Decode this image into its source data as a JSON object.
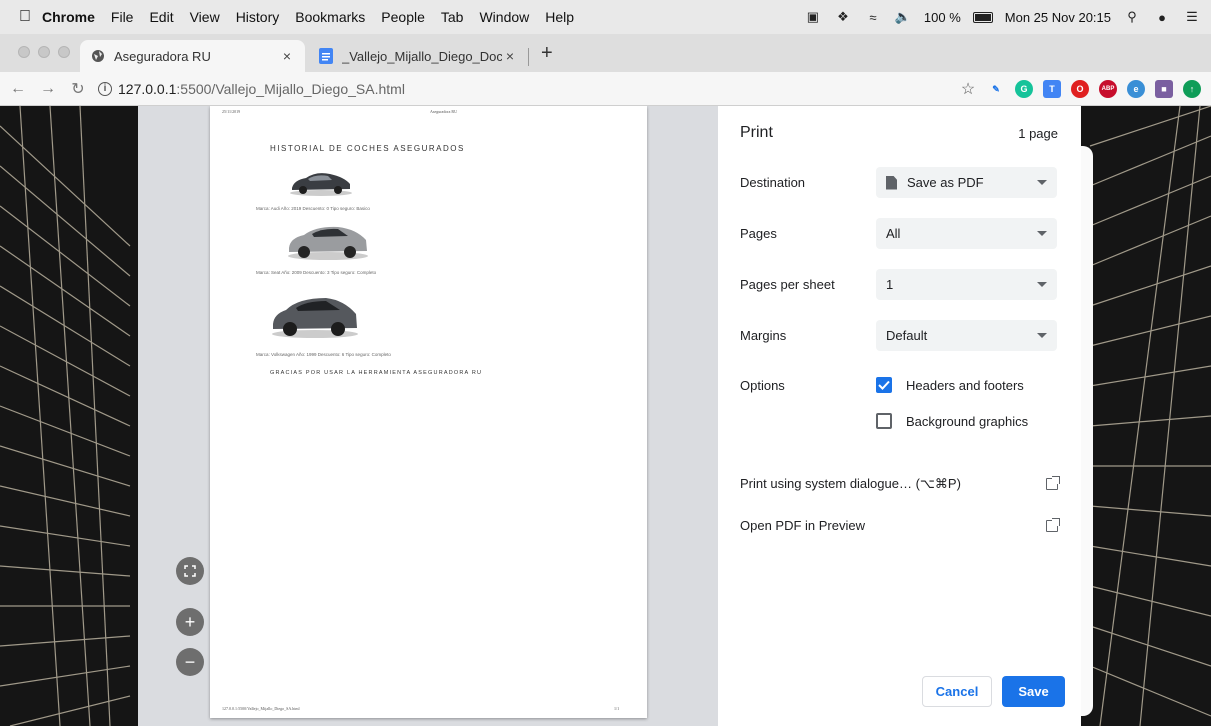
{
  "menubar": {
    "items": [
      "Chrome",
      "File",
      "Edit",
      "View",
      "History",
      "Bookmarks",
      "People",
      "Tab",
      "Window",
      "Help"
    ],
    "battery": "100 %",
    "clock": "Mon 25 Nov 20:15"
  },
  "tabs": [
    {
      "title": "Aseguradora RU",
      "close": "×",
      "icon": "globe-icon"
    },
    {
      "title": "_Vallejo_Mijallo_Diego_Docume",
      "close": "×",
      "icon": "google-docs-icon"
    }
  ],
  "new_tab": "+",
  "address": {
    "host": "127.0.0.1",
    "path": ":5500/Vallejo_Mijallo_Diego_SA.html"
  },
  "pdf": {
    "header_date": "25/11/2019",
    "header_title": "Aseguradora RU",
    "title": "HISTORIAL DE COCHES ASEGURADOS",
    "cars": [
      {
        "caption": "Marca: Audi Año: 2019 Descuento: 0 Tipo seguro: Basico"
      },
      {
        "caption": "Marca: Seat Año: 2009 Descuento: 3 Tipo seguro: Completo"
      },
      {
        "caption": "Marca: Volkswagen Año: 1999 Descuento: 6 Tipo seguro: Completo"
      }
    ],
    "thanks": "GRACIAS POR USAR LA HERRAMIENTA ASEGURADORA RU",
    "footer_url": "127.0.0.1:5500/Vallejo_Mijallo_Diego_SA.html",
    "footer_page": "1/1"
  },
  "print": {
    "title": "Print",
    "page_count": "1 page",
    "destination_label": "Destination",
    "destination_value": "Save as PDF",
    "pages_label": "Pages",
    "pages_value": "All",
    "per_sheet_label": "Pages per sheet",
    "per_sheet_value": "1",
    "margins_label": "Margins",
    "margins_value": "Default",
    "options_label": "Options",
    "headers_footers": "Headers and footers",
    "headers_footers_checked": true,
    "background_graphics": "Background graphics",
    "background_graphics_checked": false,
    "system_dialog": "Print using system dialogue… (⌥⌘P)",
    "open_preview": "Open PDF in Preview",
    "cancel": "Cancel",
    "save": "Save"
  },
  "colors": {
    "accent": "#1a73e8"
  }
}
